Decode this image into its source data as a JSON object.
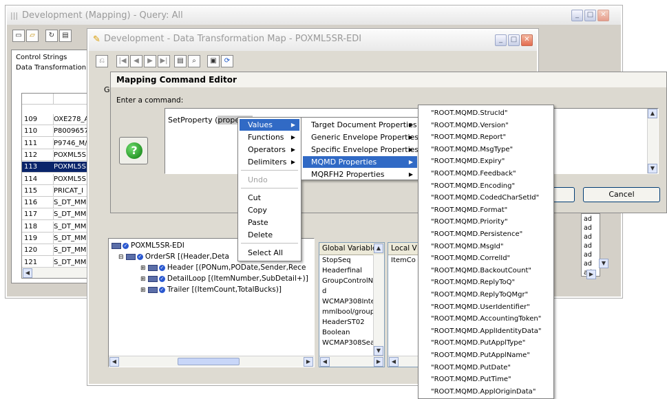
{
  "back_window": {
    "title": "Development (Mapping) - Query: All",
    "tabs": [
      "Control Strings",
      "Data Transformation"
    ],
    "rows": [
      {
        "id": "109",
        "name": "OXE278_A"
      },
      {
        "id": "110",
        "name": "P8009657"
      },
      {
        "id": "111",
        "name": "P9746_M/"
      },
      {
        "id": "112",
        "name": "POXML5S"
      },
      {
        "id": "113",
        "name": "POXML5S",
        "selected": true
      },
      {
        "id": "114",
        "name": "POXML5S"
      },
      {
        "id": "115",
        "name": "PRICAT_I"
      },
      {
        "id": "116",
        "name": "S_DT_MM"
      },
      {
        "id": "117",
        "name": "S_DT_MM"
      },
      {
        "id": "118",
        "name": "S_DT_MM"
      },
      {
        "id": "119",
        "name": "S_DT_MM"
      },
      {
        "id": "120",
        "name": "S_DT_MM"
      },
      {
        "id": "121",
        "name": "S_DT_MM"
      }
    ],
    "right_col": [
      "ad",
      "ad",
      "ad",
      "ad",
      "ad",
      "ad",
      "ad"
    ]
  },
  "map_window": {
    "title": "Development - Data Transformation Map - POXML5SR-EDI",
    "tab_letter": "G",
    "tree": {
      "root": "POXML5SR-EDI",
      "order": "OrderSR [(Header,Deta",
      "header": "Header [(PONum,PODate,Sender,Rece",
      "detail": "DetailLoop [(ItemNumber,SubDetail+)]",
      "trailer": "Trailer [(ItemCount,TotalBucks)]"
    },
    "global_vars": {
      "header": "Global Variable",
      "items": [
        "StopSeq",
        "Headerfinal",
        "GroupControlN",
        "d",
        "WCMAP308Inte",
        "mmlbool/groupt",
        "HeaderST02",
        "Boolean",
        "WCMAP308Sea"
      ]
    },
    "local_vars": {
      "header": "Local V",
      "items": [
        "ItemCo"
      ]
    }
  },
  "editor": {
    "title": "Mapping Command Editor",
    "prompt": "Enter a command:",
    "command_prefix": "SetProperty (",
    "command_selected": "propertyI",
    "cancel_label": "Cancel",
    "help_icon": "question-mark-icon"
  },
  "context_menu": {
    "items": [
      {
        "label": "Values",
        "submenu": true,
        "highlighted": true
      },
      {
        "label": "Functions",
        "submenu": true
      },
      {
        "label": "Operators",
        "submenu": true
      },
      {
        "label": "Delimiters",
        "submenu": true
      },
      {
        "label": "Undo",
        "disabled": true
      },
      {
        "label": "Cut"
      },
      {
        "label": "Copy"
      },
      {
        "label": "Paste"
      },
      {
        "label": "Delete"
      },
      {
        "label": "Select All"
      }
    ]
  },
  "values_submenu": {
    "items": [
      {
        "label": "Target Document Properties"
      },
      {
        "label": "Generic Envelope Properties"
      },
      {
        "label": "Specific Envelope Properties"
      },
      {
        "label": "MQMD Properties",
        "highlighted": true
      },
      {
        "label": "MQRFH2 Properties"
      }
    ]
  },
  "mqmd_submenu": {
    "items": [
      "\"ROOT.MQMD.StrucId\"",
      "\"ROOT.MQMD.Version\"",
      "\"ROOT.MQMD.Report\"",
      "\"ROOT.MQMD.MsgType\"",
      "\"ROOT.MQMD.Expiry\"",
      "\"ROOT.MQMD.Feedback\"",
      "\"ROOT.MQMD.Encoding\"",
      "\"ROOT.MQMD.CodedCharSetId\"",
      "\"ROOT.MQMD.Format\"",
      "\"ROOT.MQMD.Priority\"",
      "\"ROOT.MQMD.Persistence\"",
      "\"ROOT.MQMD.MsgId\"",
      "\"ROOT.MQMD.CorrelId\"",
      "\"ROOT.MQMD.BackoutCount\"",
      "\"ROOT.MQMD.ReplyToQ\"",
      "\"ROOT.MQMD.ReplyToQMgr\"",
      "\"ROOT.MQMD.UserIdentifier\"",
      "\"ROOT.MQMD.AccountingToken\"",
      "\"ROOT.MQMD.ApplIdentityData\"",
      "\"ROOT.MQMD.PutApplType\"",
      "\"ROOT.MQMD.PutApplName\"",
      "\"ROOT.MQMD.PutDate\"",
      "\"ROOT.MQMD.PutTime\"",
      "\"ROOT.MQMD.ApplOriginData\""
    ]
  }
}
